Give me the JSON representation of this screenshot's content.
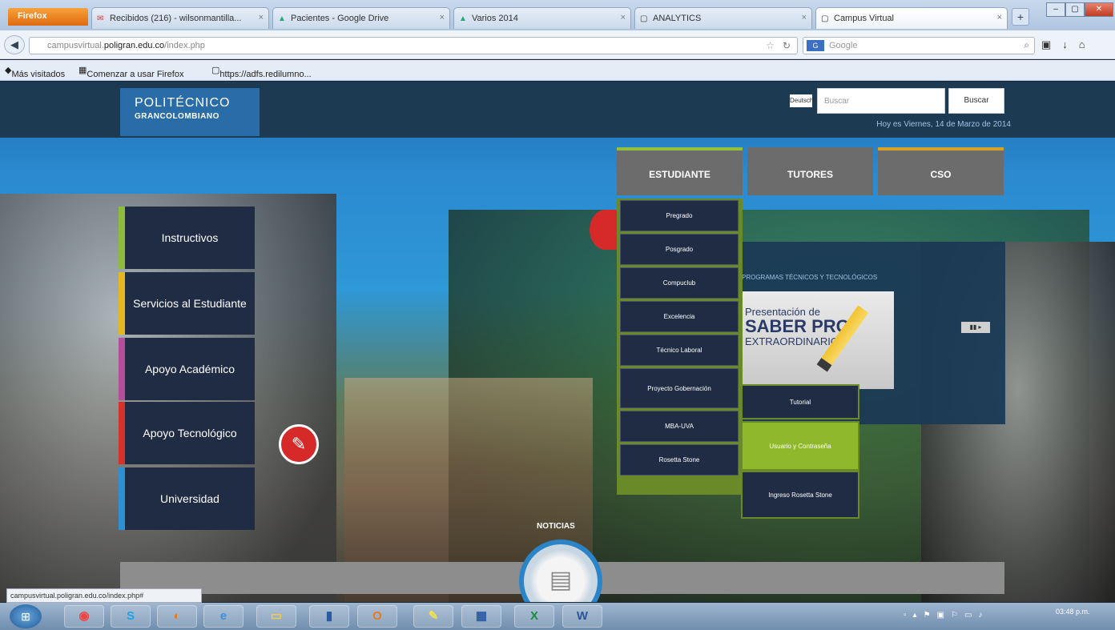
{
  "browser": {
    "firefox_button": "Firefox",
    "tabs": [
      {
        "icon": "gmail-icon",
        "label": "Recibidos (216) - wilsonmantilla..."
      },
      {
        "icon": "google-drive-icon",
        "label": "Pacientes - Google Drive"
      },
      {
        "icon": "google-drive-icon",
        "label": "Varios 2014"
      },
      {
        "icon": "page-icon",
        "label": "ANALYTICS"
      },
      {
        "icon": "page-icon",
        "label": "Campus Virtual"
      }
    ],
    "new_tab": "+",
    "url_prefix": "campusvirtual.",
    "url_domain": "poligran.edu.co",
    "url_path": "/index.php",
    "search_engine": "Google",
    "search_placeholder": "Google",
    "bookmarks": [
      "Más visitados",
      "Comenzar a usar Firefox",
      "https://adfs.redilumno..."
    ],
    "status_url": "campusvirtual.poligran.edu.co/index.php#"
  },
  "site": {
    "logo_line1": "POLITÉCNICO",
    "logo_line2": "GRANCOLOMBIANO",
    "lang": "Deutsch",
    "search_placeholder": "Buscar",
    "search_button": "Buscar",
    "date": "Hoy es Viernes, 14 de Marzo de 2014",
    "top_nav": [
      "ESTUDIANTE",
      "TUTORES",
      "CSO"
    ],
    "side_menu": [
      "Instructivos",
      "Servicios al Estudiante",
      "Apoyo Académico",
      "Apoyo Tecnológico",
      "Universidad"
    ],
    "dropdown": [
      "Pregrado",
      "Posgrado",
      "Compuclub",
      "Excelencia",
      "Técnico Laboral",
      "Proyecto Gobernación",
      "MBA-UVA",
      "Rosetta Stone"
    ],
    "promo_header": "PROGRAMAS TÉCNICOS Y TECNOLÓGICOS",
    "promo_line1": "Presentación de",
    "promo_line2": "SABER PRO",
    "promo_line3": "EXTRAORDINARIO",
    "sub_buttons": [
      "Tutorial",
      "Usuario y Contraseña",
      "Ingreso Rosetta Stone"
    ],
    "news_label": "NOTICIAS"
  },
  "taskbar": {
    "clock": "03:48 p.m.",
    "apps": [
      "chrome-icon",
      "skype-icon",
      "firefox-icon",
      "ie-icon",
      "explorer-icon",
      "notes-icon",
      "outlook-icon",
      "paint-icon",
      "remote-icon",
      "excel-icon",
      "word-icon"
    ]
  }
}
